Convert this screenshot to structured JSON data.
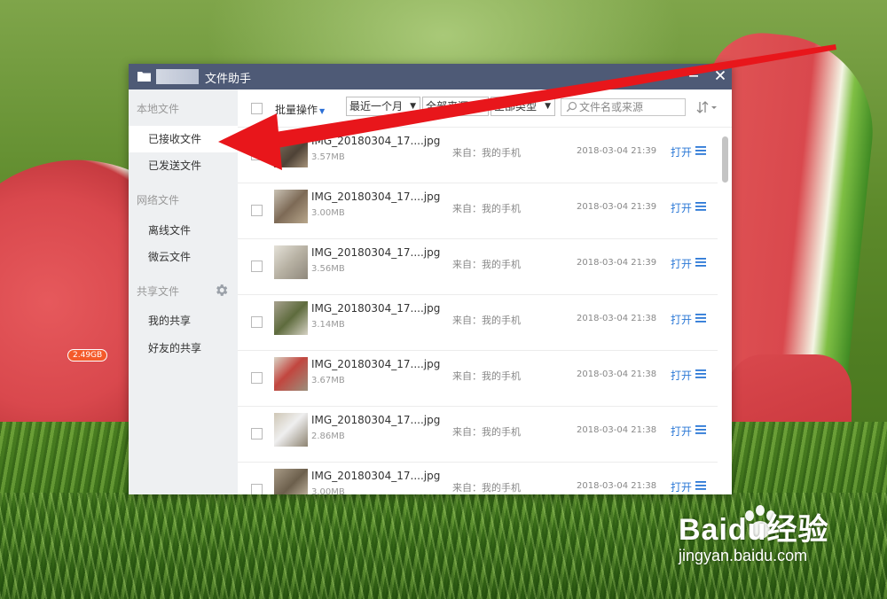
{
  "window": {
    "title": "文件助手"
  },
  "sidebar": {
    "local_section": "本地文件",
    "network_section": "网络文件",
    "shared_section": "共享文件",
    "items": [
      {
        "label": "已接收文件",
        "active": true
      },
      {
        "label": "已发送文件",
        "active": false
      },
      {
        "label": "离线文件",
        "active": false
      },
      {
        "label": "微云文件",
        "active": false
      },
      {
        "label": "我的共享",
        "active": false
      },
      {
        "label": "好友的共享",
        "active": false
      }
    ]
  },
  "toolbar": {
    "batch_label": "批量操作",
    "time_filter": "最近一个月",
    "source_filter": "全部来源",
    "type_filter": "全部类型",
    "search_placeholder": "文件名或来源"
  },
  "files": [
    {
      "name": "IMG_20180304_17....jpg",
      "size": "3.57MB",
      "source": "来自：我的手机",
      "date": "2018-03-04 21:39",
      "action": "打开"
    },
    {
      "name": "IMG_20180304_17....jpg",
      "size": "3.00MB",
      "source": "来自：我的手机",
      "date": "2018-03-04 21:39",
      "action": "打开"
    },
    {
      "name": "IMG_20180304_17....jpg",
      "size": "3.56MB",
      "source": "来自：我的手机",
      "date": "2018-03-04 21:39",
      "action": "打开"
    },
    {
      "name": "IMG_20180304_17....jpg",
      "size": "3.14MB",
      "source": "来自：我的手机",
      "date": "2018-03-04 21:38",
      "action": "打开"
    },
    {
      "name": "IMG_20180304_17....jpg",
      "size": "3.67MB",
      "source": "来自：我的手机",
      "date": "2018-03-04 21:38",
      "action": "打开"
    },
    {
      "name": "IMG_20180304_17....jpg",
      "size": "2.86MB",
      "source": "来自：我的手机",
      "date": "2018-03-04 21:38",
      "action": "打开"
    },
    {
      "name": "IMG_20180304_17....jpg",
      "size": "3.00MB",
      "source": "来自：我的手机",
      "date": "2018-03-04 21:38",
      "action": "打开"
    }
  ],
  "desktop": {
    "storage_badge": "2.49GB",
    "watermark_brand": "Baidu经验",
    "watermark_url": "jingyan.baidu.com"
  },
  "colors": {
    "titlebar": "#4e5a76",
    "accent_link": "#2b78d6",
    "annotation_arrow": "#e8161b",
    "sidebar_bg": "#eef0f2"
  },
  "icons": [
    "folder-icon",
    "minimize-icon",
    "close-icon",
    "gear-icon",
    "search-icon",
    "sort-icon",
    "menu-icon",
    "caret-down-icon"
  ]
}
